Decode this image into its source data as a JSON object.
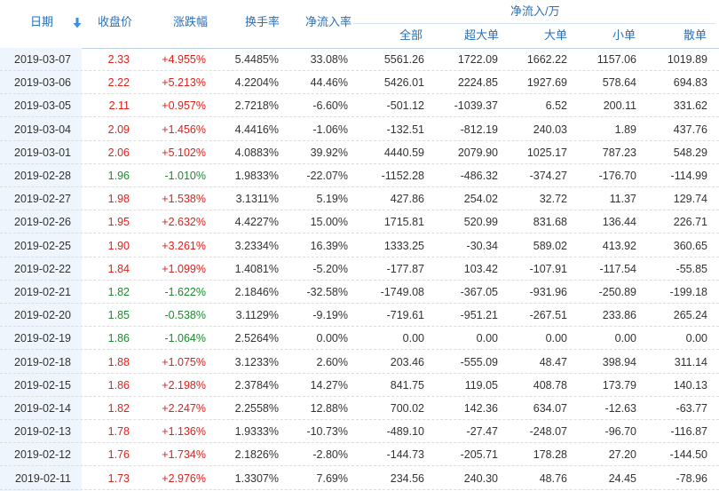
{
  "headers": {
    "date": "日期",
    "close": "收盘价",
    "change": "涨跌幅",
    "turnover": "换手率",
    "net_inflow_rate": "净流入率",
    "group": "净流入/万",
    "all": "全部",
    "xlarge": "超大单",
    "large": "大单",
    "small": "小单",
    "retail": "散单"
  },
  "colors": {
    "up": "#e0211b",
    "down": "#1d8a2f",
    "header": "#2b6fb6",
    "date_bg": "#eef5fc"
  },
  "rows": [
    {
      "date": "2019-03-07",
      "close": "2.33",
      "change": "+4.955%",
      "turnover": "5.4485%",
      "net": "33.08%",
      "all": "5561.26",
      "xl": "1722.09",
      "l": "1662.22",
      "m": "1157.06",
      "s": "1019.89",
      "dir": "up"
    },
    {
      "date": "2019-03-06",
      "close": "2.22",
      "change": "+5.213%",
      "turnover": "4.2204%",
      "net": "44.46%",
      "all": "5426.01",
      "xl": "2224.85",
      "l": "1927.69",
      "m": "578.64",
      "s": "694.83",
      "dir": "up"
    },
    {
      "date": "2019-03-05",
      "close": "2.11",
      "change": "+0.957%",
      "turnover": "2.7218%",
      "net": "-6.60%",
      "all": "-501.12",
      "xl": "-1039.37",
      "l": "6.52",
      "m": "200.11",
      "s": "331.62",
      "dir": "up"
    },
    {
      "date": "2019-03-04",
      "close": "2.09",
      "change": "+1.456%",
      "turnover": "4.4416%",
      "net": "-1.06%",
      "all": "-132.51",
      "xl": "-812.19",
      "l": "240.03",
      "m": "1.89",
      "s": "437.76",
      "dir": "up"
    },
    {
      "date": "2019-03-01",
      "close": "2.06",
      "change": "+5.102%",
      "turnover": "4.0883%",
      "net": "39.92%",
      "all": "4440.59",
      "xl": "2079.90",
      "l": "1025.17",
      "m": "787.23",
      "s": "548.29",
      "dir": "up"
    },
    {
      "date": "2019-02-28",
      "close": "1.96",
      "change": "-1.010%",
      "turnover": "1.9833%",
      "net": "-22.07%",
      "all": "-1152.28",
      "xl": "-486.32",
      "l": "-374.27",
      "m": "-176.70",
      "s": "-114.99",
      "dir": "down"
    },
    {
      "date": "2019-02-27",
      "close": "1.98",
      "change": "+1.538%",
      "turnover": "3.1311%",
      "net": "5.19%",
      "all": "427.86",
      "xl": "254.02",
      "l": "32.72",
      "m": "11.37",
      "s": "129.74",
      "dir": "up"
    },
    {
      "date": "2019-02-26",
      "close": "1.95",
      "change": "+2.632%",
      "turnover": "4.4227%",
      "net": "15.00%",
      "all": "1715.81",
      "xl": "520.99",
      "l": "831.68",
      "m": "136.44",
      "s": "226.71",
      "dir": "up"
    },
    {
      "date": "2019-02-25",
      "close": "1.90",
      "change": "+3.261%",
      "turnover": "3.2334%",
      "net": "16.39%",
      "all": "1333.25",
      "xl": "-30.34",
      "l": "589.02",
      "m": "413.92",
      "s": "360.65",
      "dir": "up"
    },
    {
      "date": "2019-02-22",
      "close": "1.84",
      "change": "+1.099%",
      "turnover": "1.4081%",
      "net": "-5.20%",
      "all": "-177.87",
      "xl": "103.42",
      "l": "-107.91",
      "m": "-117.54",
      "s": "-55.85",
      "dir": "up"
    },
    {
      "date": "2019-02-21",
      "close": "1.82",
      "change": "-1.622%",
      "turnover": "2.1846%",
      "net": "-32.58%",
      "all": "-1749.08",
      "xl": "-367.05",
      "l": "-931.96",
      "m": "-250.89",
      "s": "-199.18",
      "dir": "down"
    },
    {
      "date": "2019-02-20",
      "close": "1.85",
      "change": "-0.538%",
      "turnover": "3.1129%",
      "net": "-9.19%",
      "all": "-719.61",
      "xl": "-951.21",
      "l": "-267.51",
      "m": "233.86",
      "s": "265.24",
      "dir": "down"
    },
    {
      "date": "2019-02-19",
      "close": "1.86",
      "change": "-1.064%",
      "turnover": "2.5264%",
      "net": "0.00%",
      "all": "0.00",
      "xl": "0.00",
      "l": "0.00",
      "m": "0.00",
      "s": "0.00",
      "dir": "down"
    },
    {
      "date": "2019-02-18",
      "close": "1.88",
      "change": "+1.075%",
      "turnover": "3.1233%",
      "net": "2.60%",
      "all": "203.46",
      "xl": "-555.09",
      "l": "48.47",
      "m": "398.94",
      "s": "311.14",
      "dir": "up"
    },
    {
      "date": "2019-02-15",
      "close": "1.86",
      "change": "+2.198%",
      "turnover": "2.3784%",
      "net": "14.27%",
      "all": "841.75",
      "xl": "119.05",
      "l": "408.78",
      "m": "173.79",
      "s": "140.13",
      "dir": "up"
    },
    {
      "date": "2019-02-14",
      "close": "1.82",
      "change": "+2.247%",
      "turnover": "2.2558%",
      "net": "12.88%",
      "all": "700.02",
      "xl": "142.36",
      "l": "634.07",
      "m": "-12.63",
      "s": "-63.77",
      "dir": "up"
    },
    {
      "date": "2019-02-13",
      "close": "1.78",
      "change": "+1.136%",
      "turnover": "1.9333%",
      "net": "-10.73%",
      "all": "-489.10",
      "xl": "-27.47",
      "l": "-248.07",
      "m": "-96.70",
      "s": "-116.87",
      "dir": "up"
    },
    {
      "date": "2019-02-12",
      "close": "1.76",
      "change": "+1.734%",
      "turnover": "2.1826%",
      "net": "-2.80%",
      "all": "-144.73",
      "xl": "-205.71",
      "l": "178.28",
      "m": "27.20",
      "s": "-144.50",
      "dir": "up"
    },
    {
      "date": "2019-02-11",
      "close": "1.73",
      "change": "+2.976%",
      "turnover": "1.3307%",
      "net": "7.69%",
      "all": "234.56",
      "xl": "240.30",
      "l": "48.76",
      "m": "24.45",
      "s": "-78.96",
      "dir": "up"
    }
  ]
}
